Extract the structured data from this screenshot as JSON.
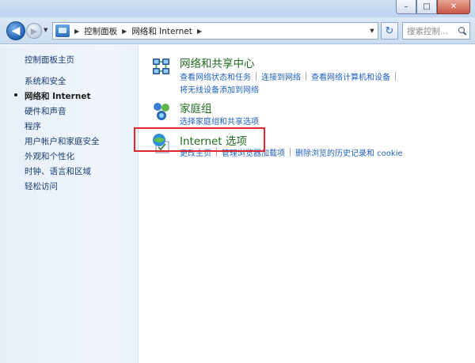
{
  "window": {
    "minimize_glyph": "–",
    "maximize_glyph": "□",
    "close_glyph": "✕"
  },
  "nav": {
    "back_glyph": "◀",
    "forward_glyph": "▶",
    "history_glyph": "▼",
    "refresh_glyph": "↻",
    "address_icon": "control-panel-icon",
    "breadcrumbs": [
      "控制面板",
      "网络和 Internet"
    ],
    "search_placeholder": "搜索控制..."
  },
  "sidebar": {
    "home": "控制面板主页",
    "items": [
      {
        "label": "系统和安全",
        "current": false
      },
      {
        "label": "网络和 Internet",
        "current": true
      },
      {
        "label": "硬件和声音",
        "current": false
      },
      {
        "label": "程序",
        "current": false
      },
      {
        "label": "用户帐户和家庭安全",
        "current": false
      },
      {
        "label": "外观和个性化",
        "current": false
      },
      {
        "label": "时钟、语言和区域",
        "current": false
      },
      {
        "label": "轻松访问",
        "current": false
      }
    ]
  },
  "main": {
    "categories": [
      {
        "title": "网络和共享中心",
        "icon": "network-sharing-icon",
        "links_row1": [
          "查看网络状态和任务",
          "连接到网络",
          "查看网络计算机和设备"
        ],
        "links_row2": [
          "将无线设备添加到网络"
        ]
      },
      {
        "title": "家庭组",
        "icon": "homegroup-icon",
        "links_row1": [
          "选择家庭组和共享选项"
        ]
      },
      {
        "title": "Internet 选项",
        "icon": "internet-options-icon",
        "links_row1": [
          "更改主页",
          "管理浏览器加载项",
          "删除浏览的历史记录和 cookie"
        ]
      }
    ],
    "highlight_color": "#e0262c"
  }
}
